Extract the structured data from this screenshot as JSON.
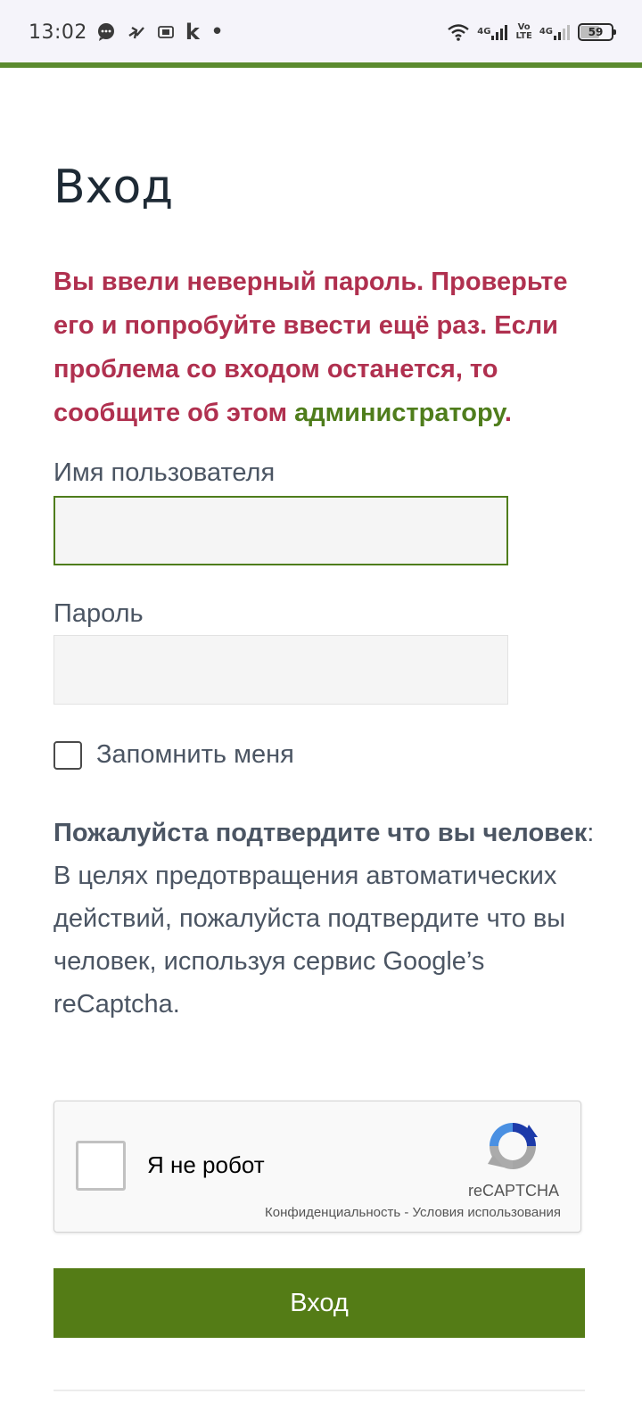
{
  "status_bar": {
    "time": "13:02",
    "left_icons": [
      "chat-bubble-icon",
      "runner-icon",
      "sim-card-icon",
      "k-app-icon",
      "dot-icon"
    ],
    "k_glyph": "k",
    "dot_glyph": "•",
    "network1": "4G",
    "volte_top": "Vo",
    "volte_bottom": "LTE",
    "network2": "4G",
    "battery_level": "59",
    "battery_fraction": 0.59
  },
  "page": {
    "title": "Вход",
    "error": {
      "text": "Вы ввели неверный пароль. Проверьте его и попробуйте ввести ещё раз. Если проблема со входом останется, то сообщите об этом ",
      "link": "администратору",
      "end": "."
    },
    "username": {
      "label": "Имя пользователя",
      "value": ""
    },
    "password": {
      "label": "Пароль",
      "value": ""
    },
    "remember_label": "Запомнить меня",
    "human": {
      "title": "Пожалуйста подтвердите что вы человек",
      "colon": ":",
      "text": "В целях предотвращения автоматических действий, пожалуйста подтвердите что вы человек, используя сервис Google’s reCaptcha."
    },
    "recaptcha": {
      "label": "Я не робот",
      "brand": "reCAPTCHA",
      "privacy": "Конфиденциальность",
      "separator": "-",
      "terms": "Условия использования"
    },
    "submit_label": "Вход"
  },
  "colors": {
    "accent_green": "#547c16",
    "error_red": "#b0304f",
    "link_green": "#4f7d1c"
  }
}
